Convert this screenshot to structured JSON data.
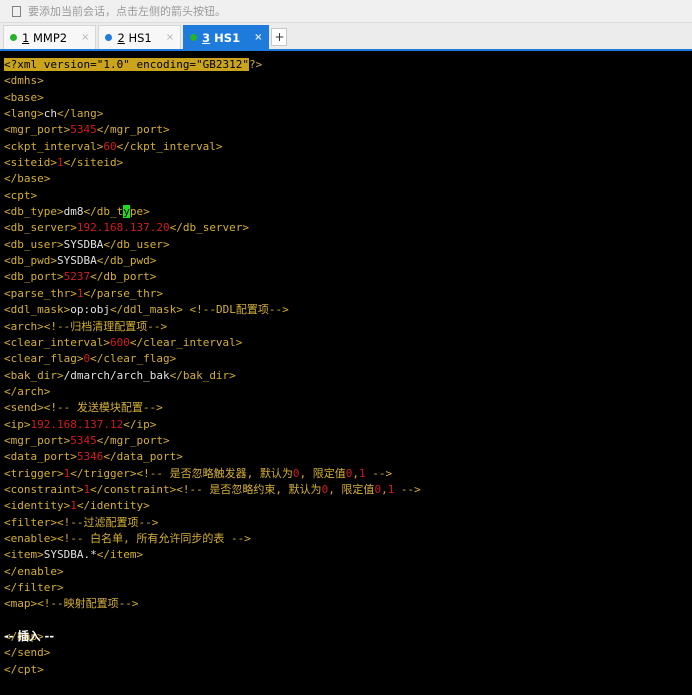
{
  "hint": "要添加当前会话，点击左侧的箭头按钮。",
  "tabs": [
    {
      "num": "1",
      "title": "MMP2",
      "dot": "#27b327",
      "close": "×"
    },
    {
      "num": "2",
      "title": "HS1",
      "dot": "#1e7bdc",
      "close": "×"
    },
    {
      "num": "3",
      "title": "HS1",
      "dot": "#27b327",
      "close": "×"
    }
  ],
  "add_tab": "+",
  "status": "-- 插入 --",
  "lines": [
    [
      [
        "hl",
        "<?"
      ],
      [
        "hl",
        "xml version=\"1.0\" encoding=\"GB2312\""
      ],
      [
        "t",
        "?>"
      ]
    ],
    [
      [
        "t",
        "<dmhs>"
      ]
    ],
    [
      [
        "t",
        "<base>"
      ]
    ],
    [
      [
        "t",
        "<lang>"
      ],
      [
        "v",
        "ch"
      ],
      [
        "t",
        "</lang>"
      ]
    ],
    [
      [
        "t",
        "<mgr_port>"
      ],
      [
        "n",
        "5345"
      ],
      [
        "t",
        "</mgr_port>"
      ]
    ],
    [
      [
        "t",
        "<ckpt_interval>"
      ],
      [
        "n",
        "60"
      ],
      [
        "t",
        "</ckpt_interval>"
      ]
    ],
    [
      [
        "t",
        "<siteid>"
      ],
      [
        "n",
        "1"
      ],
      [
        "t",
        "</siteid>"
      ]
    ],
    [
      [
        "t",
        "</base>"
      ]
    ],
    [
      [
        "t",
        "<cpt>"
      ]
    ],
    [
      [
        "t",
        "<db_type>"
      ],
      [
        "v",
        "dm8"
      ],
      [
        "t",
        "</db_t"
      ],
      [
        "cur",
        "y"
      ],
      [
        "t",
        "pe>"
      ]
    ],
    [
      [
        "t",
        "<db_server>"
      ],
      [
        "n",
        "192.168.137.20"
      ],
      [
        "t",
        "</db_server>"
      ]
    ],
    [
      [
        "t",
        "<db_user>"
      ],
      [
        "v",
        "SYSDBA"
      ],
      [
        "t",
        "</db_user>"
      ]
    ],
    [
      [
        "t",
        "<db_pwd>"
      ],
      [
        "v",
        "SYSDBA"
      ],
      [
        "t",
        "</db_pwd>"
      ]
    ],
    [
      [
        "t",
        "<db_port>"
      ],
      [
        "n",
        "5237"
      ],
      [
        "t",
        "</db_port>"
      ]
    ],
    [
      [
        "t",
        "<parse_thr>"
      ],
      [
        "n",
        "1"
      ],
      [
        "t",
        "</parse_thr>"
      ]
    ],
    [
      [
        "t",
        "<ddl_mask>"
      ],
      [
        "v",
        "op:obj"
      ],
      [
        "t",
        "</ddl_mask>"
      ],
      [
        "v",
        " "
      ],
      [
        "c",
        "<!--DDL配置项-->"
      ]
    ],
    [
      [
        "t",
        "<arch>"
      ],
      [
        "c",
        "<!--归档清理配置项-->"
      ]
    ],
    [
      [
        "t",
        "<clear_interval>"
      ],
      [
        "n",
        "600"
      ],
      [
        "t",
        "</clear_interval>"
      ]
    ],
    [
      [
        "t",
        "<clear_flag>"
      ],
      [
        "n",
        "0"
      ],
      [
        "t",
        "</clear_flag>"
      ]
    ],
    [
      [
        "t",
        "<bak_dir>"
      ],
      [
        "v",
        "/dmarch/arch_bak"
      ],
      [
        "t",
        "</bak_dir>"
      ]
    ],
    [
      [
        "t",
        "</arch>"
      ]
    ],
    [
      [
        "t",
        "<send>"
      ],
      [
        "c",
        "<!-- 发送模块配置-->"
      ]
    ],
    [
      [
        "t",
        "<ip>"
      ],
      [
        "n",
        "192.168.137.12"
      ],
      [
        "t",
        "</ip>"
      ]
    ],
    [
      [
        "t",
        "<mgr_port>"
      ],
      [
        "n",
        "5345"
      ],
      [
        "t",
        "</mgr_port>"
      ]
    ],
    [
      [
        "t",
        "<data_port>"
      ],
      [
        "n",
        "5346"
      ],
      [
        "t",
        "</data_port>"
      ]
    ],
    [
      [
        "t",
        "<trigger>"
      ],
      [
        "n",
        "1"
      ],
      [
        "t",
        "</trigger>"
      ],
      [
        "c",
        "<!-- 是否忽略触发器, 默认为"
      ],
      [
        "n",
        "0"
      ],
      [
        "c",
        ", 限定值"
      ],
      [
        "n",
        "0"
      ],
      [
        "c",
        ","
      ],
      [
        "n",
        "1"
      ],
      [
        "c",
        " -->"
      ]
    ],
    [
      [
        "t",
        "<constraint>"
      ],
      [
        "n",
        "1"
      ],
      [
        "t",
        "</constraint>"
      ],
      [
        "c",
        "<!-- 是否忽略约束, 默认为"
      ],
      [
        "n",
        "0"
      ],
      [
        "c",
        ", 限定值"
      ],
      [
        "n",
        "0"
      ],
      [
        "c",
        ","
      ],
      [
        "n",
        "1"
      ],
      [
        "c",
        " -->"
      ]
    ],
    [
      [
        "t",
        "<identity>"
      ],
      [
        "n",
        "1"
      ],
      [
        "t",
        "</identity>"
      ]
    ],
    [
      [
        "t",
        "<filter>"
      ],
      [
        "c",
        "<!--过滤配置项-->"
      ]
    ],
    [
      [
        "t",
        "<enable>"
      ],
      [
        "c",
        "<!-- 白名单, 所有允许同步的表 -->"
      ]
    ],
    [
      [
        "t",
        "<item>"
      ],
      [
        "v",
        "SYSDBA.*"
      ],
      [
        "t",
        "</item>"
      ]
    ],
    [
      [
        "t",
        "</enable>"
      ]
    ],
    [
      [
        "t",
        "</filter>"
      ]
    ],
    [
      [
        "t",
        "<map>"
      ],
      [
        "c",
        "<!--映射配置项-->"
      ]
    ],
    [],
    [
      [
        "t",
        "</map>"
      ]
    ],
    [
      [
        "t",
        "</send>"
      ]
    ],
    [
      [
        "t",
        "</cpt>"
      ]
    ]
  ]
}
